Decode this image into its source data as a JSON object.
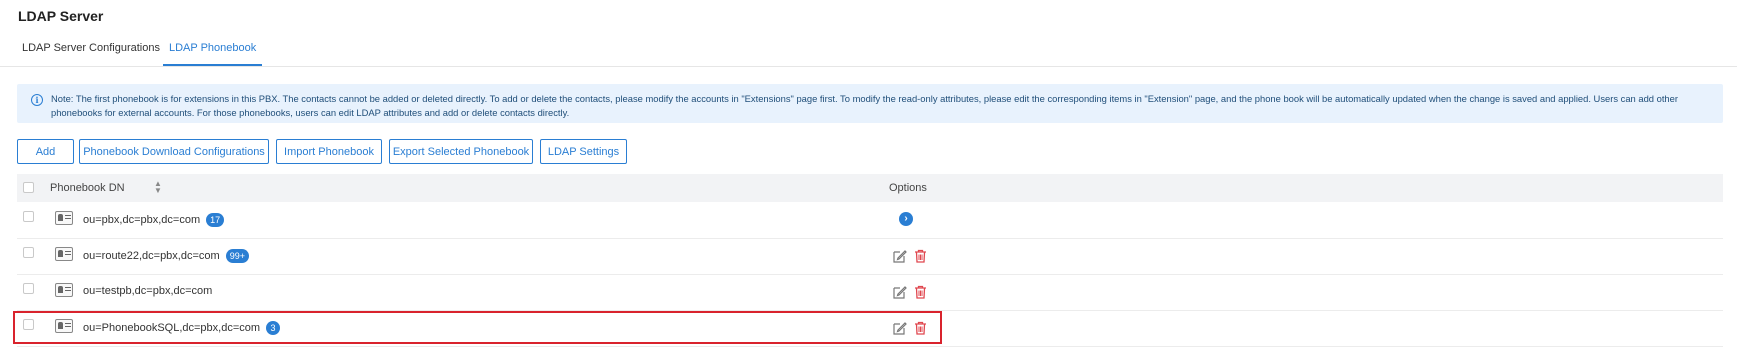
{
  "page_title": "LDAP Server",
  "tabs": [
    {
      "label": "LDAP Server Configurations",
      "active": false
    },
    {
      "label": "LDAP Phonebook",
      "active": true
    }
  ],
  "note": {
    "icon": "info-icon",
    "text": "Note: The first phonebook is for extensions in this PBX. The contacts cannot be added or deleted directly. To add or delete the contacts, please modify the accounts in \"Extensions\" page first. To modify the read-only attributes, please edit the corresponding items in \"Extension\" page, and the phone book will be automatically updated when the change is saved and applied. Users can add other phonebooks for external accounts. For those phonebooks, users can edit LDAP attributes and add or delete contacts directly."
  },
  "toolbar": {
    "add": "Add",
    "download_config": "Phonebook Download Configurations",
    "import": "Import Phonebook",
    "export": "Export Selected Phonebook",
    "ldap_settings": "LDAP Settings"
  },
  "table": {
    "columns": {
      "dn": "Phonebook DN",
      "options": "Options"
    },
    "rows": [
      {
        "dn": "ou=pbx,dc=pbx,dc=com",
        "count": "17",
        "options": [
          "enter-icon"
        ]
      },
      {
        "dn": "ou=route22,dc=pbx,dc=com",
        "count": "99+",
        "options": [
          "edit-icon",
          "delete-icon"
        ]
      },
      {
        "dn": "ou=testpb,dc=pbx,dc=com",
        "count": "",
        "options": [
          "edit-icon",
          "delete-icon"
        ]
      },
      {
        "dn": "ou=PhonebookSQL,dc=pbx,dc=com",
        "count": "3",
        "options": [
          "edit-icon",
          "delete-icon"
        ],
        "highlighted": true
      }
    ]
  },
  "colors": {
    "accent": "#2a7ed3",
    "delete": "#e0474f",
    "note_bg": "#e8f2fd",
    "highlight": "#d9232d"
  }
}
